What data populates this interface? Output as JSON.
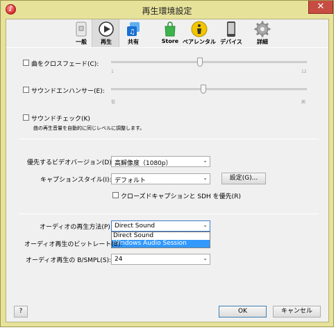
{
  "window": {
    "title": "再生環境設定"
  },
  "toolbar": {
    "tabs": [
      {
        "label": "一般",
        "icon": "general-icon"
      },
      {
        "label": "再生",
        "icon": "play-icon"
      },
      {
        "label": "共有",
        "icon": "sharing-icon"
      },
      {
        "label": "Store",
        "icon": "store-icon"
      },
      {
        "label": "ペアレンタル",
        "icon": "parental-icon"
      },
      {
        "label": "デバイス",
        "icon": "device-icon"
      },
      {
        "label": "詳細",
        "icon": "gear-icon"
      }
    ],
    "active_tab": "再生"
  },
  "crossfade": {
    "label": "曲をクロスフェード(C):",
    "checked": false,
    "min_label": "1",
    "max_label": "12"
  },
  "sound_enhancer": {
    "label": "サウンドエンハンサー(E):",
    "checked": false,
    "min_label": "低",
    "max_label": "高"
  },
  "sound_check": {
    "label": "サウンドチェック(K)",
    "checked": false,
    "description": "曲の再生音量を自動的に同じレベルに調整します。"
  },
  "video": {
    "preferred_label": "優先するビデオバージョン(D):",
    "preferred_value": "高解像度（1080p）",
    "caption_label": "キャプションスタイル(I):",
    "caption_value": "デフォルト",
    "settings_button": "設定(G)...",
    "closed_caption_label": "クローズドキャプションと SDH を優先(R)",
    "closed_caption_checked": false
  },
  "audio": {
    "playback_label": "オーディオの再生方法(P):",
    "playback_value": "Direct Sound",
    "playback_options": [
      "Direct Sound",
      "Windows Audio Session"
    ],
    "highlighted_option": "Windows Audio Session",
    "bitrate_label": "オーディオ再生のビットレート(B):",
    "bits_label": "オーディオ再生の B/SMPL(S):",
    "bits_value": "24"
  },
  "footer": {
    "help_button": "?",
    "ok_button": "OK",
    "cancel_button": "キャンセル"
  },
  "colors": {
    "frame": "#e7e29a",
    "close": "#c74d43",
    "highlight": "#3399ff"
  }
}
